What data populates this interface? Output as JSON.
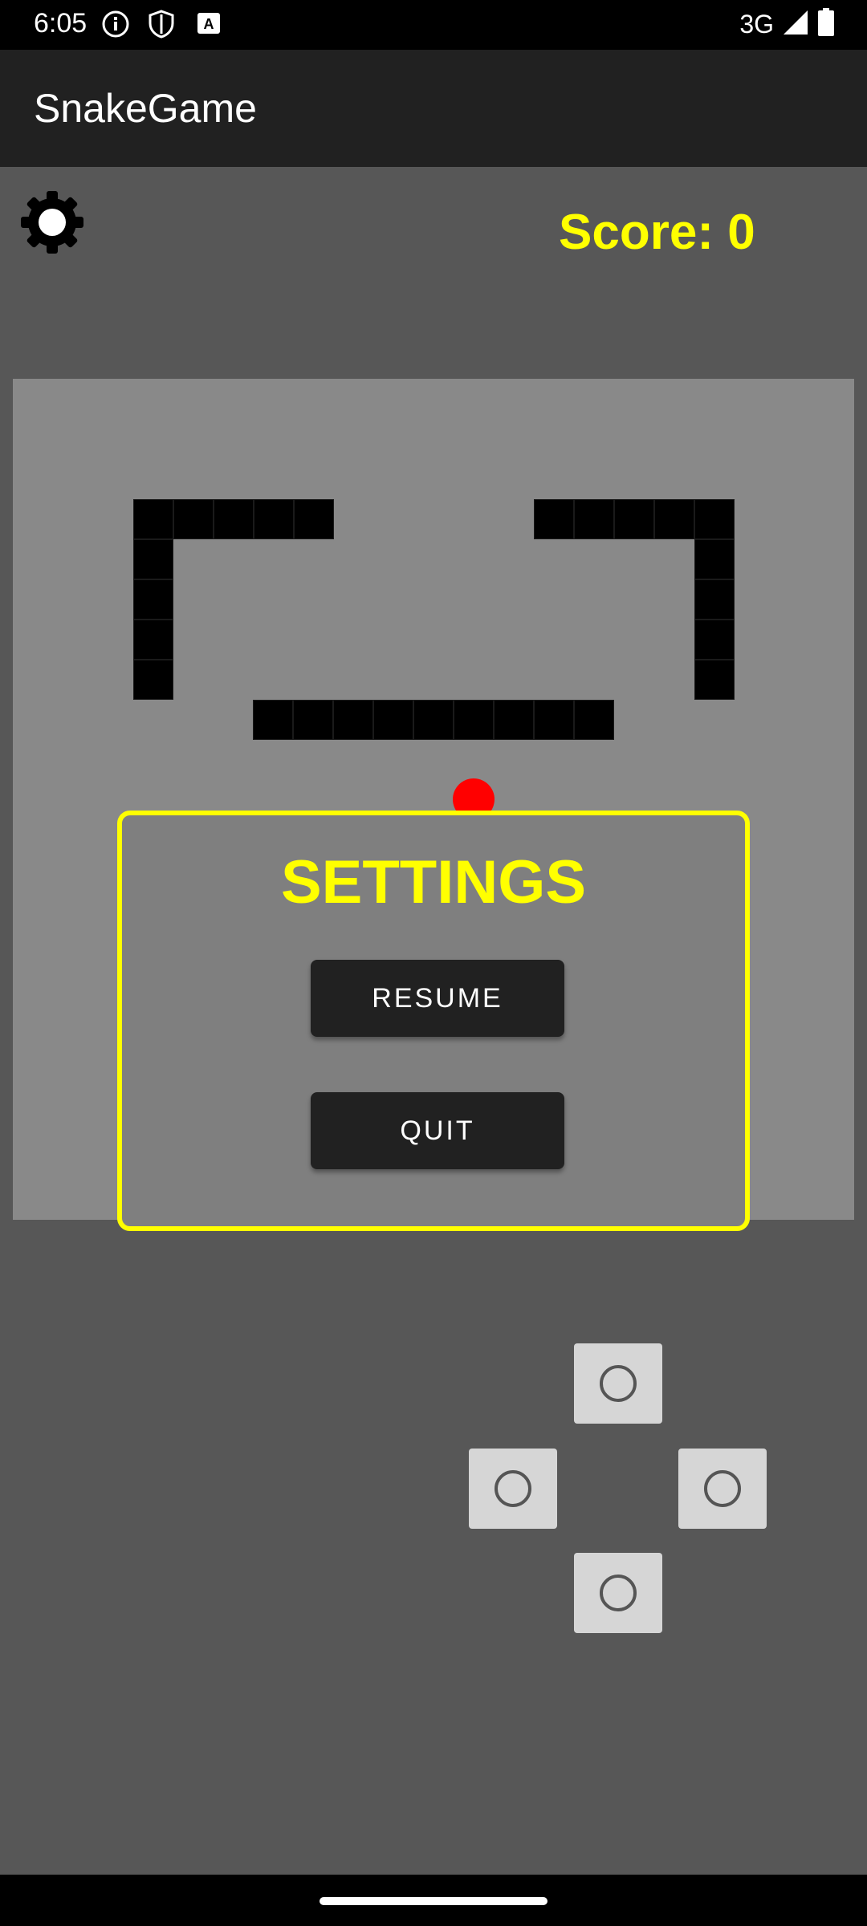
{
  "status_bar": {
    "time": "6:05",
    "network": "3G",
    "icons": [
      "info-icon",
      "shield-icon",
      "keyboard-a-icon",
      "signal-icon",
      "battery-icon"
    ]
  },
  "app_bar": {
    "title": "SnakeGame"
  },
  "game": {
    "score_text": "Score: 0",
    "settings_icon": "gear-icon"
  },
  "settings_dialog": {
    "title": "SETTINGS",
    "resume_label": "RESUME",
    "quit_label": "QUIT"
  },
  "controls": {
    "icons": [
      "dpad-up",
      "dpad-left",
      "dpad-right",
      "dpad-down"
    ]
  },
  "colors": {
    "background": "#575757",
    "board": "#898989",
    "accent_yellow": "#ffff00",
    "food_red": "#ff0000",
    "button_dark": "#212121"
  }
}
